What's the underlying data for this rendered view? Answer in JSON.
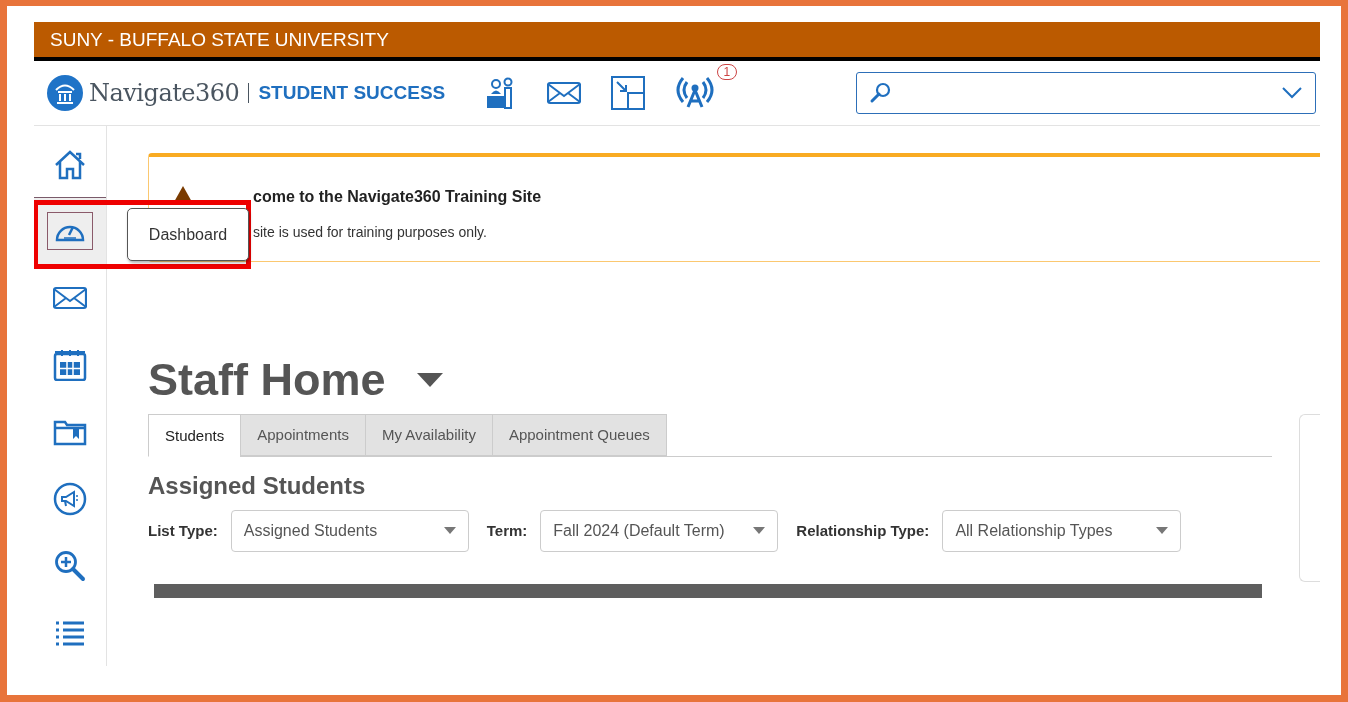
{
  "header": {
    "university": "SUNY - BUFFALO STATE UNIVERSITY"
  },
  "nav": {
    "brand": "Navigate360",
    "product": "STUDENT SUCCESS",
    "notification_count": "1"
  },
  "sidebar": {
    "items": [
      {
        "kind": "home",
        "selected": false
      },
      {
        "kind": "dashboard",
        "selected": true
      },
      {
        "kind": "mail",
        "selected": false
      },
      {
        "kind": "calendar",
        "selected": false
      },
      {
        "kind": "folder",
        "selected": false
      },
      {
        "kind": "megaphone",
        "selected": false
      },
      {
        "kind": "zoom",
        "selected": false
      },
      {
        "kind": "list",
        "selected": false
      }
    ]
  },
  "tooltip": "Dashboard",
  "banner": {
    "title": "come to the Navigate360 Training Site",
    "text": "site is used for training purposes only."
  },
  "page_title": "Staff Home",
  "tabs": [
    {
      "label": "Students",
      "selected": true
    },
    {
      "label": "Appointments",
      "selected": false
    },
    {
      "label": "My Availability",
      "selected": false
    },
    {
      "label": "Appointment Queues",
      "selected": false
    }
  ],
  "section_title": "Assigned Students",
  "filters": [
    {
      "label": "List Type:",
      "value": "Assigned Students"
    },
    {
      "label": "Term:",
      "value": "Fall 2024 (Default Term)"
    },
    {
      "label": "Relationship Type:",
      "value": "All Relationship Types"
    }
  ]
}
